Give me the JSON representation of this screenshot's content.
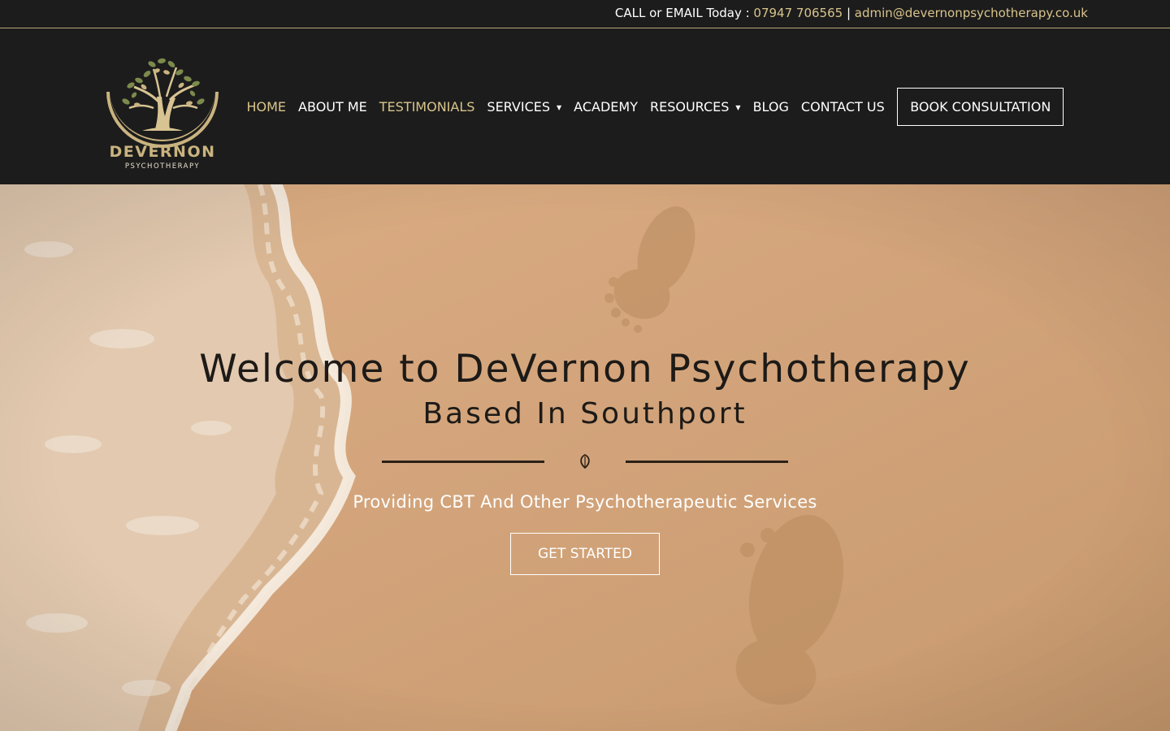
{
  "topbar": {
    "prefix": "CALL or EMAIL Today : ",
    "phone": "07947 706565",
    "separator": " | ",
    "email": "admin@devernonpsychotherapy.co.uk"
  },
  "logo": {
    "name": "DEVERNON",
    "tagline": "PSYCHOTHERAPY"
  },
  "nav": {
    "items": [
      {
        "label": "HOME",
        "active": true
      },
      {
        "label": "ABOUT ME"
      },
      {
        "label": "TESTIMONIALS",
        "active": true
      },
      {
        "label": "SERVICES",
        "dropdown": true
      },
      {
        "label": "ACADEMY"
      },
      {
        "label": "RESOURCES",
        "dropdown": true
      },
      {
        "label": "BLOG"
      },
      {
        "label": "CONTACT US"
      }
    ],
    "cta": "BOOK CONSULTATION",
    "caret_icon": "chevron-down-icon"
  },
  "hero": {
    "title": "Welcome to DeVernon Psychotherapy",
    "subtitle": "Based In Southport",
    "tagline": "Providing CBT And Other Psychotherapeutic Services",
    "button": "GET STARTED",
    "divider_icon": "leaf-icon"
  },
  "colors": {
    "accent": "#d9c48b",
    "background": "#1c1c1c",
    "sand": "#cfa176"
  }
}
